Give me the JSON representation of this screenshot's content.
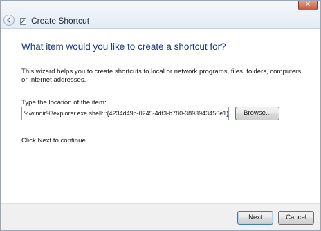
{
  "window": {
    "title": "Create Shortcut",
    "close_glyph": "✕",
    "back_icon": "back-arrow-icon",
    "app_icon": "shortcut-icon"
  },
  "wizard": {
    "heading": "What item would you like to create a shortcut for?",
    "description": "This wizard helps you to create shortcuts to local or network programs, files, folders, computers, or Internet addresses.",
    "field_label": "Type the location of the item:",
    "location_value": "%windir%\\explorer.exe shell:::{4234d49b-0245-4df3-b780-3893943456e1}",
    "browse_label": "Browse...",
    "hint": "Click Next to continue."
  },
  "footer": {
    "next_label": "Next",
    "cancel_label": "Cancel"
  },
  "colors": {
    "heading": "#1a3b8e",
    "input_border": "#7a9cc8",
    "close_button": "#c7573a"
  }
}
